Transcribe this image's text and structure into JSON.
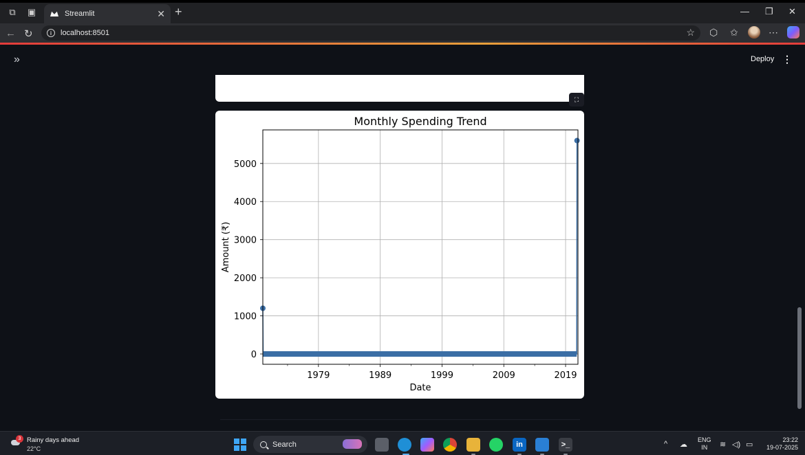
{
  "browser": {
    "tab_title": "Streamlit",
    "tab_close": "✕",
    "new_tab": "+",
    "url": "localhost:8501",
    "icons": [
      "workspaces-icon",
      "tab-actions-icon",
      "back-icon",
      "reload-icon",
      "info-icon",
      "favorite-star-icon",
      "extensions-icon",
      "favorites-icon",
      "profile-avatar",
      "more-icon",
      "copilot-icon"
    ]
  },
  "streamlit": {
    "sidebar_toggle": "»",
    "deploy_label": "Deploy",
    "menu_glyph": "⋮",
    "fullscreen_glyph": "⛶"
  },
  "chart_data": {
    "type": "line",
    "title": "Monthly Spending Trend",
    "xlabel": "Date",
    "ylabel": "Amount (₹)",
    "x_ticks": [
      "1979",
      "1989",
      "1999",
      "2009",
      "2019"
    ],
    "x_tick_years": [
      1979,
      1989,
      1999,
      2009,
      2019
    ],
    "y_ticks": [
      0,
      1000,
      2000,
      3000,
      4000,
      5000
    ],
    "xlim": [
      1970.0,
      2021.0
    ],
    "ylim": [
      -270,
      5880
    ],
    "grid": true,
    "series": [
      {
        "color": "#3b6ea5",
        "marker": "circle",
        "points": [
          {
            "x": 1970.0,
            "y": 1200
          },
          {
            "x": 1970.05,
            "y": 0
          },
          {
            "x": 2020.8,
            "y": 0
          },
          {
            "x": 2020.85,
            "y": 5600
          }
        ]
      }
    ]
  },
  "taskbar": {
    "weather_title": "Rainy days ahead",
    "weather_temp": "22°C",
    "weather_badge": "3",
    "search_placeholder": "Search",
    "lang_line1": "ENG",
    "lang_line2": "IN",
    "time": "23:22",
    "date": "19-07-2025"
  }
}
